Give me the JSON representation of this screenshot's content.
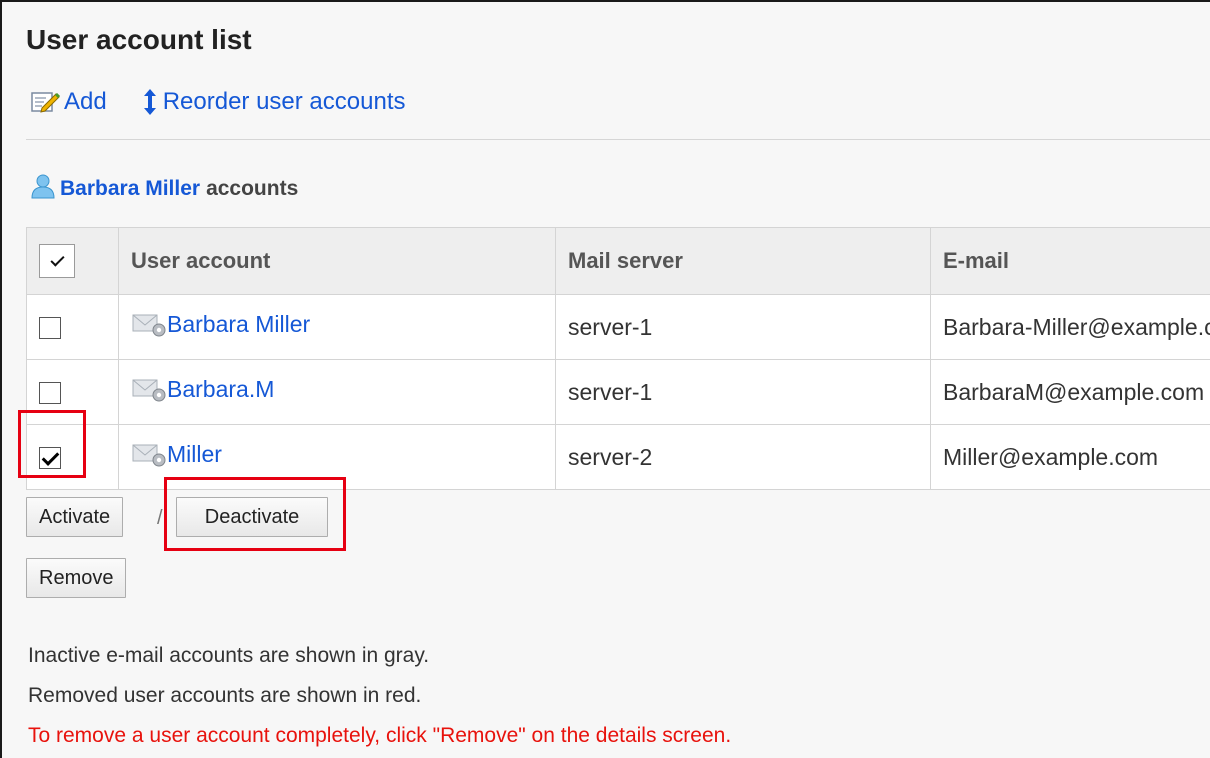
{
  "page": {
    "title": "User account list"
  },
  "toolbar": {
    "add_label": "Add",
    "add_icon": "edit-icon",
    "reorder_label": "Reorder user accounts",
    "reorder_icon": "reorder-arrows-icon"
  },
  "section": {
    "owner_name": "Barbara Miller",
    "suffix": "accounts",
    "icon": "user-icon"
  },
  "table": {
    "columns": [
      "User account",
      "Mail server",
      "E-mail"
    ],
    "select_all_checked": true,
    "rows": [
      {
        "checked": false,
        "account": "Barbara Miller",
        "server": "server-1",
        "email": "Barbara-Miller@example.com"
      },
      {
        "checked": false,
        "account": "Barbara.M",
        "server": "server-1",
        "email": "BarbaraM@example.com"
      },
      {
        "checked": true,
        "account": "Miller",
        "server": "server-2",
        "email": "Miller@example.com"
      }
    ]
  },
  "actions": {
    "activate": "Activate",
    "separator": "/",
    "deactivate": "Deactivate",
    "remove": "Remove"
  },
  "notes": {
    "gray": "Inactive e-mail accounts are shown in gray.",
    "red_removed": "Removed user accounts are shown in red.",
    "warning": "To remove a user account completely, click \"Remove\" on the details screen."
  },
  "colors": {
    "link": "#1558d6",
    "highlight": "#e60012",
    "warning": "#e8120c"
  }
}
